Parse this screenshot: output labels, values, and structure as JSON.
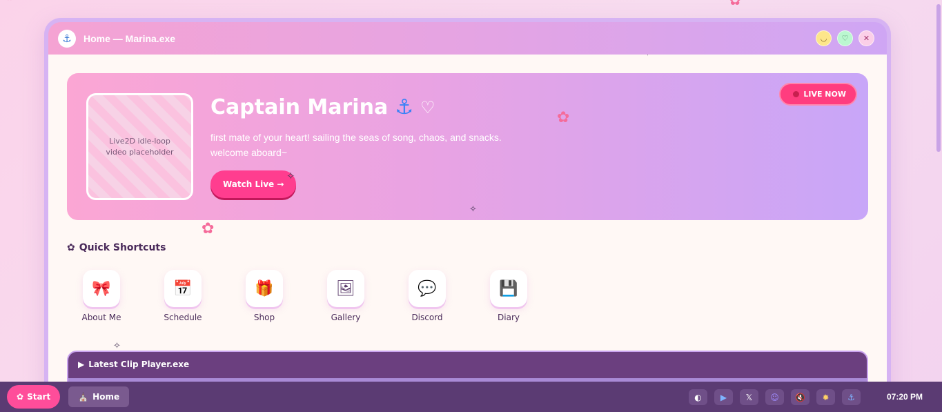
{
  "window": {
    "title": "Home — Marina.exe",
    "controls": {
      "minimize": "◡",
      "maximize": "♡",
      "close": "✕"
    }
  },
  "hero": {
    "video_placeholder": "Live2D idle-loop video placeholder",
    "title": "Captain Marina",
    "subtitle": "first mate of your heart! sailing the seas of song, chaos, and snacks. welcome aboard~",
    "watch_button": "Watch Live →",
    "live_badge": "LIVE NOW"
  },
  "shortcuts": {
    "title": "Quick Shortcuts",
    "items": [
      {
        "label": "About Me",
        "icon": "bow-icon",
        "glyph": "🎀"
      },
      {
        "label": "Schedule",
        "icon": "calendar-icon",
        "glyph": "📅"
      },
      {
        "label": "Shop",
        "icon": "gift-icon",
        "glyph": "🎁"
      },
      {
        "label": "Gallery",
        "icon": "picture-frame-icon",
        "glyph": "🖼"
      },
      {
        "label": "Discord",
        "icon": "speech-bubble-icon",
        "glyph": "💬"
      },
      {
        "label": "Diary",
        "icon": "floppy-disk-icon",
        "glyph": "💾"
      }
    ]
  },
  "clip_player": {
    "title": "Latest Clip Player.exe"
  },
  "taskbar": {
    "start": "Start",
    "home": "Home",
    "tray": [
      "moon-icon",
      "play-icon",
      "x-icon",
      "discord-icon",
      "mute-icon",
      "sun-icon",
      "anchor-icon"
    ],
    "clock": "07:20 PM"
  },
  "colors": {
    "accent": "#ff3d8f",
    "window_border": "#d6b3f3",
    "taskbar": "#5b3b73"
  }
}
